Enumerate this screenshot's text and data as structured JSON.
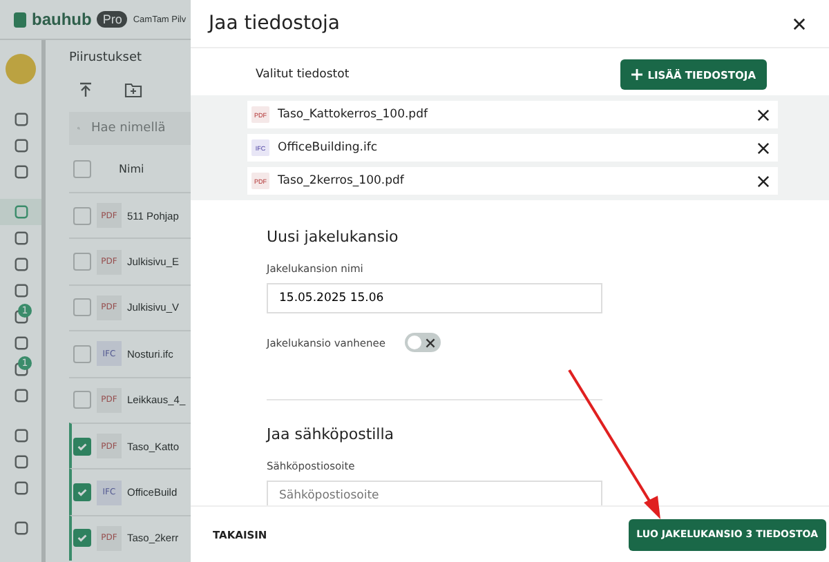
{
  "app": {
    "logo": "bauhub",
    "plan_badge": "Pro",
    "project": "CamTam Pilv",
    "page_title": "Piirustukset",
    "search": {
      "placeholder": "Hae nimellä"
    },
    "column": "Nimi",
    "all_checked": false,
    "nav": [
      {
        "selected": false
      },
      {
        "selected": false
      },
      {
        "selected": false
      },
      {
        "selected": true
      },
      {
        "selected": false
      },
      {
        "selected": false
      },
      {
        "selected": false
      },
      {
        "selected": false,
        "badge": "1"
      },
      {
        "selected": false
      },
      {
        "selected": false,
        "badge": "1"
      },
      {
        "selected": false
      },
      {
        "selected": false
      },
      {
        "selected": false
      },
      {
        "selected": false
      },
      {
        "selected": false
      }
    ],
    "rows": [
      {
        "type": "PDF",
        "name": "511 Pohjap",
        "checked": false
      },
      {
        "type": "PDF",
        "name": "Julkisivu_E",
        "checked": false
      },
      {
        "type": "PDF",
        "name": "Julkisivu_V",
        "checked": false
      },
      {
        "type": "IFC",
        "name": "Nosturi.ifc",
        "checked": false
      },
      {
        "type": "PDF",
        "name": "Leikkaus_4_",
        "checked": false
      },
      {
        "type": "PDF",
        "name": "Taso_Katto",
        "checked": true
      },
      {
        "type": "IFC",
        "name": "OfficeBuild",
        "checked": true
      },
      {
        "type": "PDF",
        "name": "Taso_2kerr",
        "checked": true
      }
    ]
  },
  "dialog": {
    "title": "Jaa tiedostoja",
    "selected_label": "Valitut tiedostot",
    "add_button": "LISÄÄ TIEDOSTOJA",
    "files": [
      {
        "type": "PDF",
        "name": "Taso_Kattokerros_100.pdf"
      },
      {
        "type": "IFC",
        "name": "OfficeBuilding.ifc"
      },
      {
        "type": "PDF",
        "name": "Taso_2kerros_100.pdf"
      }
    ],
    "folder_heading": "Uusi jakelukansio",
    "name_label": "Jakelukansion nimi",
    "name_value": "15.05.2025 15.06",
    "expires_label": "Jakelukansio vanhenee",
    "expires_on": false,
    "email_heading": "Jaa sähköpostilla",
    "email_label": "Sähköpostiosoite",
    "email_placeholder": "Sähköpostiosoite",
    "back_button": "TAKAISIN",
    "create_button": "LUO JAKELUKANSIO 3 TIEDOSTOA"
  }
}
